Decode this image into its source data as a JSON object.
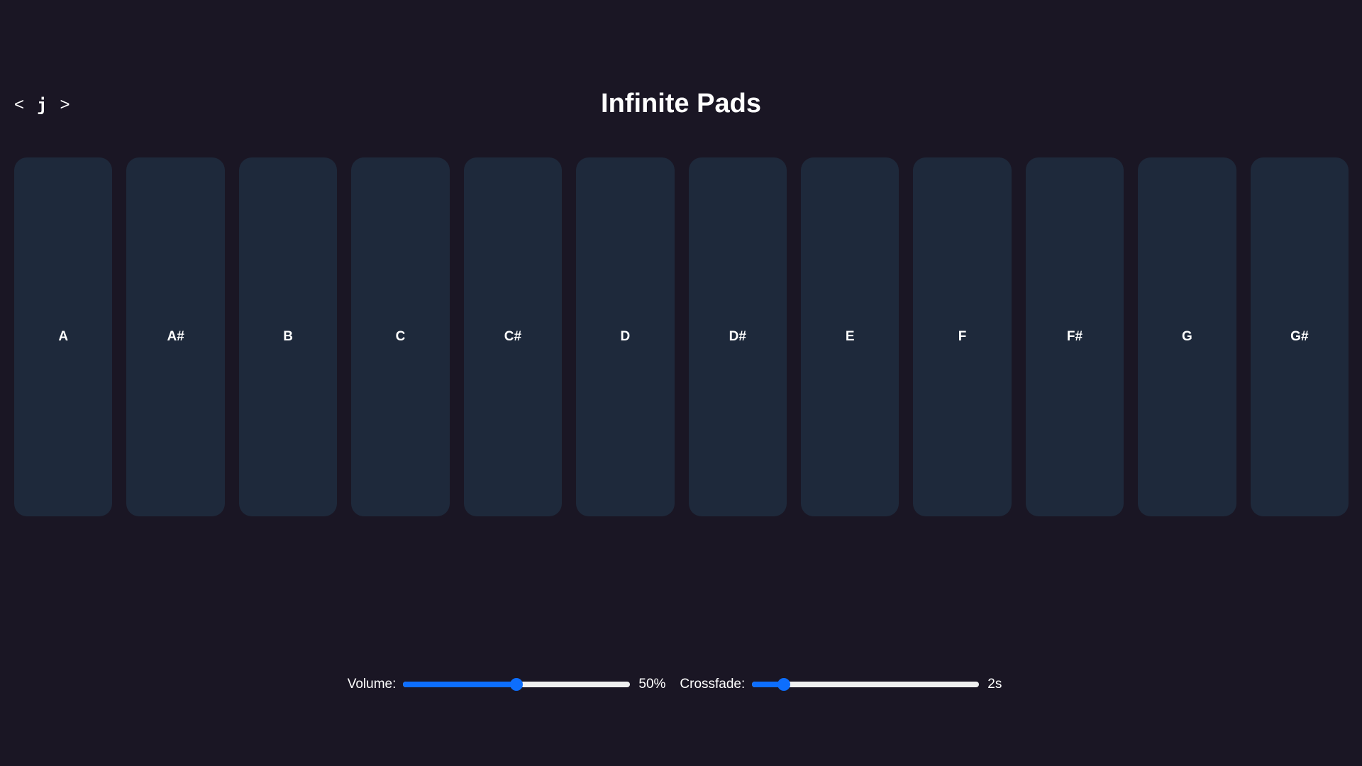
{
  "header": {
    "title": "Infinite Pads",
    "prev_label": "<",
    "key_label": "j",
    "next_label": ">"
  },
  "pads": [
    {
      "label": "A"
    },
    {
      "label": "A#"
    },
    {
      "label": "B"
    },
    {
      "label": "C"
    },
    {
      "label": "C#"
    },
    {
      "label": "D"
    },
    {
      "label": "D#"
    },
    {
      "label": "E"
    },
    {
      "label": "F"
    },
    {
      "label": "F#"
    },
    {
      "label": "G"
    },
    {
      "label": "G#"
    }
  ],
  "controls": {
    "volume": {
      "label": "Volume:",
      "value_text": "50%",
      "value": 0.5
    },
    "crossfade": {
      "label": "Crossfade:",
      "value_text": "2s",
      "value": 0.14
    }
  },
  "colors": {
    "background": "#1a1624",
    "pad": "#1e293b",
    "accent": "#0d6efd",
    "track": "#f0f0f0"
  }
}
